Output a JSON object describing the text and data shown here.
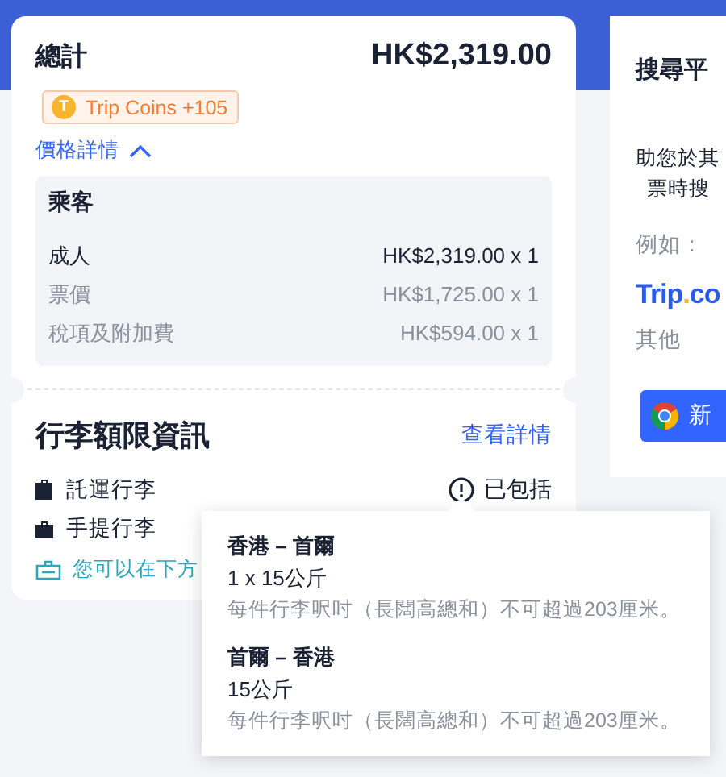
{
  "summary": {
    "total_label": "總計",
    "total_value": "HK$2,319.00",
    "coins": {
      "icon_letter": "T",
      "text": "Trip Coins +105"
    },
    "details_link": {
      "label": "價格詳情",
      "expanded": true
    },
    "passenger": {
      "heading": "乘客",
      "rows": [
        {
          "label": "成人",
          "value": "HK$2,319.00 x 1",
          "kind": "main"
        },
        {
          "label": "票價",
          "value": "HK$1,725.00 x 1",
          "kind": "sub"
        },
        {
          "label": "稅項及附加費",
          "value": "HK$594.00 x 1",
          "kind": "sub"
        }
      ]
    }
  },
  "baggage": {
    "title": "行李額限資訊",
    "link": "查看詳情",
    "items": [
      {
        "kind": "checked",
        "label": "託運行李",
        "status": "已包括"
      },
      {
        "kind": "carry",
        "label": "手提行李"
      }
    ],
    "note": "您可以在下方"
  },
  "tooltip": {
    "segments": [
      {
        "route": "香港 – 首爾",
        "allowance": "1 x 15公斤",
        "rule": "每件行李呎吋（長闊高總和）不可超過203厘米。"
      },
      {
        "route": "首爾 – 香港",
        "allowance": "15公斤",
        "rule": "每件行李呎吋（長闊高總和）不可超過203厘米。"
      }
    ]
  },
  "side_panel": {
    "title": "搜尋平",
    "lines": [
      "助您於其",
      "票時搜"
    ],
    "example_label": "例如：",
    "logo": {
      "main": "Trip",
      "dot": ".",
      "tail": "co"
    },
    "other": "其他",
    "button": "新"
  }
}
